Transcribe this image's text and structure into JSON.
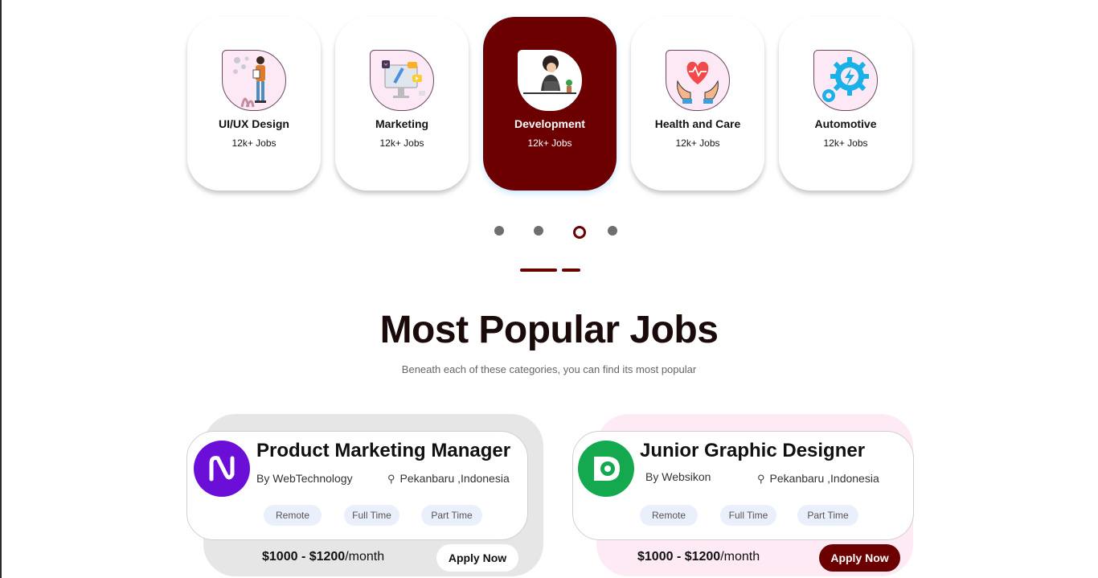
{
  "categories": [
    {
      "title": "UI/UX Design",
      "count": "12k+ Jobs",
      "icon": "designer-illustration-icon"
    },
    {
      "title": "Marketing",
      "count": "12k+ Jobs",
      "icon": "marketing-illustration-icon"
    },
    {
      "title": "Development",
      "count": "12k+ Jobs",
      "icon": "developer-illustration-icon"
    },
    {
      "title": "Health and Care",
      "count": "12k+ Jobs",
      "icon": "heart-hands-icon"
    },
    {
      "title": "Automotive",
      "count": "12k+ Jobs",
      "icon": "gears-icon"
    }
  ],
  "carousel": {
    "page_count": 4,
    "active_index": 2
  },
  "section": {
    "title": "Most Popular Jobs",
    "subtitle": "Beneath each of these categories, you can find its most popular"
  },
  "jobs": [
    {
      "title": "Product Marketing Manager",
      "company": "By WebTechnology",
      "location": "Pekanbaru ,Indonesia",
      "tags": [
        "Remote",
        "Full Time",
        "Part Time"
      ],
      "salary_range": "$1000 - $1200",
      "salary_period": "/month",
      "apply_label": "Apply Now",
      "logo_color": "#6b0fd8"
    },
    {
      "title": "Junior Graphic Designer",
      "company": "By Websikon",
      "location": "Pekanbaru ,Indonesia",
      "tags": [
        "Remote",
        "Full Time",
        "Part Time"
      ],
      "salary_range": "$1000 - $1200",
      "salary_period": "/month",
      "apply_label": "Apply Now",
      "logo_color": "#14a84f"
    }
  ],
  "colors": {
    "accent": "#6c0000",
    "tag_bg": "#e9effb",
    "pink_bg": "#fde8f6"
  }
}
